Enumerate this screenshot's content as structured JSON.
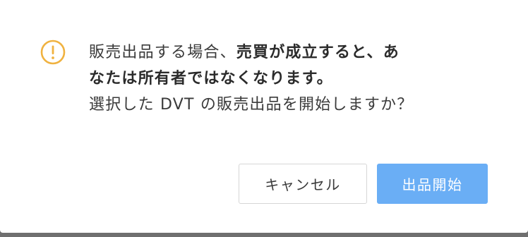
{
  "dialog": {
    "icon": "exclamation-circle-icon",
    "icon_color": "#f0b240",
    "message": {
      "line1_normal": "販売出品する場合、",
      "line1_bold": "売買が成立すると、あ",
      "line2_bold": "なたは所有者ではなくなります。",
      "line3": "選択した DVT の販売出品を開始しますか？"
    },
    "buttons": {
      "cancel_label": "キャンセル",
      "confirm_label": "出品開始"
    }
  },
  "colors": {
    "primary": "#6aaef5",
    "warning": "#f0b240",
    "text": "#3a3a3a"
  }
}
